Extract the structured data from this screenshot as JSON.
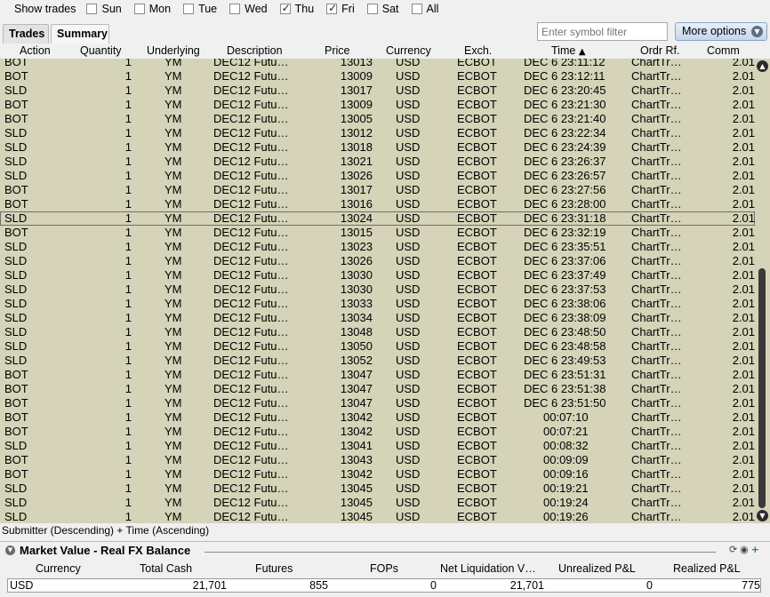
{
  "filter_bar": {
    "label": "Show trades",
    "days": [
      {
        "label": "Sun",
        "checked": false
      },
      {
        "label": "Mon",
        "checked": false
      },
      {
        "label": "Tue",
        "checked": false
      },
      {
        "label": "Wed",
        "checked": false
      },
      {
        "label": "Thu",
        "checked": true
      },
      {
        "label": "Fri",
        "checked": true
      },
      {
        "label": "Sat",
        "checked": false
      },
      {
        "label": "All",
        "checked": false
      }
    ]
  },
  "tabs": [
    "Trades",
    "Summary"
  ],
  "symbol_filter_placeholder": "Enter symbol filter",
  "more_options_label": "More options",
  "columns": [
    "Action",
    "Quantity",
    "Underlying",
    "Description",
    "Price",
    "Currency",
    "Exch.",
    "Time",
    "Ordr Rf.",
    "Comm"
  ],
  "trades": [
    [
      "BOT",
      "1",
      "YM",
      "DEC12 Futu…",
      "13013",
      "USD",
      "ECBOT",
      "DEC 6 23:11:12",
      "ChartTr…",
      "2.01"
    ],
    [
      "BOT",
      "1",
      "YM",
      "DEC12 Futu…",
      "13009",
      "USD",
      "ECBOT",
      "DEC 6 23:12:11",
      "ChartTr…",
      "2.01"
    ],
    [
      "SLD",
      "1",
      "YM",
      "DEC12 Futu…",
      "13017",
      "USD",
      "ECBOT",
      "DEC 6 23:20:45",
      "ChartTr…",
      "2.01"
    ],
    [
      "BOT",
      "1",
      "YM",
      "DEC12 Futu…",
      "13009",
      "USD",
      "ECBOT",
      "DEC 6 23:21:30",
      "ChartTr…",
      "2.01"
    ],
    [
      "BOT",
      "1",
      "YM",
      "DEC12 Futu…",
      "13005",
      "USD",
      "ECBOT",
      "DEC 6 23:21:40",
      "ChartTr…",
      "2.01"
    ],
    [
      "SLD",
      "1",
      "YM",
      "DEC12 Futu…",
      "13012",
      "USD",
      "ECBOT",
      "DEC 6 23:22:34",
      "ChartTr…",
      "2.01"
    ],
    [
      "SLD",
      "1",
      "YM",
      "DEC12 Futu…",
      "13018",
      "USD",
      "ECBOT",
      "DEC 6 23:24:39",
      "ChartTr…",
      "2.01"
    ],
    [
      "SLD",
      "1",
      "YM",
      "DEC12 Futu…",
      "13021",
      "USD",
      "ECBOT",
      "DEC 6 23:26:37",
      "ChartTr…",
      "2.01"
    ],
    [
      "SLD",
      "1",
      "YM",
      "DEC12 Futu…",
      "13026",
      "USD",
      "ECBOT",
      "DEC 6 23:26:57",
      "ChartTr…",
      "2.01"
    ],
    [
      "BOT",
      "1",
      "YM",
      "DEC12 Futu…",
      "13017",
      "USD",
      "ECBOT",
      "DEC 6 23:27:56",
      "ChartTr…",
      "2.01"
    ],
    [
      "BOT",
      "1",
      "YM",
      "DEC12 Futu…",
      "13016",
      "USD",
      "ECBOT",
      "DEC 6 23:28:00",
      "ChartTr…",
      "2.01"
    ],
    [
      "SLD",
      "1",
      "YM",
      "DEC12 Futu…",
      "13024",
      "USD",
      "ECBOT",
      "DEC 6 23:31:18",
      "ChartTr…",
      "2.01"
    ],
    [
      "BOT",
      "1",
      "YM",
      "DEC12 Futu…",
      "13015",
      "USD",
      "ECBOT",
      "DEC 6 23:32:19",
      "ChartTr…",
      "2.01"
    ],
    [
      "SLD",
      "1",
      "YM",
      "DEC12 Futu…",
      "13023",
      "USD",
      "ECBOT",
      "DEC 6 23:35:51",
      "ChartTr…",
      "2.01"
    ],
    [
      "SLD",
      "1",
      "YM",
      "DEC12 Futu…",
      "13026",
      "USD",
      "ECBOT",
      "DEC 6 23:37:06",
      "ChartTr…",
      "2.01"
    ],
    [
      "SLD",
      "1",
      "YM",
      "DEC12 Futu…",
      "13030",
      "USD",
      "ECBOT",
      "DEC 6 23:37:49",
      "ChartTr…",
      "2.01"
    ],
    [
      "SLD",
      "1",
      "YM",
      "DEC12 Futu…",
      "13030",
      "USD",
      "ECBOT",
      "DEC 6 23:37:53",
      "ChartTr…",
      "2.01"
    ],
    [
      "SLD",
      "1",
      "YM",
      "DEC12 Futu…",
      "13033",
      "USD",
      "ECBOT",
      "DEC 6 23:38:06",
      "ChartTr…",
      "2.01"
    ],
    [
      "SLD",
      "1",
      "YM",
      "DEC12 Futu…",
      "13034",
      "USD",
      "ECBOT",
      "DEC 6 23:38:09",
      "ChartTr…",
      "2.01"
    ],
    [
      "SLD",
      "1",
      "YM",
      "DEC12 Futu…",
      "13048",
      "USD",
      "ECBOT",
      "DEC 6 23:48:50",
      "ChartTr…",
      "2.01"
    ],
    [
      "SLD",
      "1",
      "YM",
      "DEC12 Futu…",
      "13050",
      "USD",
      "ECBOT",
      "DEC 6 23:48:58",
      "ChartTr…",
      "2.01"
    ],
    [
      "SLD",
      "1",
      "YM",
      "DEC12 Futu…",
      "13052",
      "USD",
      "ECBOT",
      "DEC 6 23:49:53",
      "ChartTr…",
      "2.01"
    ],
    [
      "BOT",
      "1",
      "YM",
      "DEC12 Futu…",
      "13047",
      "USD",
      "ECBOT",
      "DEC 6 23:51:31",
      "ChartTr…",
      "2.01"
    ],
    [
      "BOT",
      "1",
      "YM",
      "DEC12 Futu…",
      "13047",
      "USD",
      "ECBOT",
      "DEC 6 23:51:38",
      "ChartTr…",
      "2.01"
    ],
    [
      "BOT",
      "1",
      "YM",
      "DEC12 Futu…",
      "13047",
      "USD",
      "ECBOT",
      "DEC 6 23:51:50",
      "ChartTr…",
      "2.01"
    ],
    [
      "BOT",
      "1",
      "YM",
      "DEC12 Futu…",
      "13042",
      "USD",
      "ECBOT",
      "00:07:10",
      "ChartTr…",
      "2.01"
    ],
    [
      "BOT",
      "1",
      "YM",
      "DEC12 Futu…",
      "13042",
      "USD",
      "ECBOT",
      "00:07:21",
      "ChartTr…",
      "2.01"
    ],
    [
      "SLD",
      "1",
      "YM",
      "DEC12 Futu…",
      "13041",
      "USD",
      "ECBOT",
      "00:08:32",
      "ChartTr…",
      "2.01"
    ],
    [
      "BOT",
      "1",
      "YM",
      "DEC12 Futu…",
      "13043",
      "USD",
      "ECBOT",
      "00:09:09",
      "ChartTr…",
      "2.01"
    ],
    [
      "BOT",
      "1",
      "YM",
      "DEC12 Futu…",
      "13042",
      "USD",
      "ECBOT",
      "00:09:16",
      "ChartTr…",
      "2.01"
    ],
    [
      "SLD",
      "1",
      "YM",
      "DEC12 Futu…",
      "13045",
      "USD",
      "ECBOT",
      "00:19:21",
      "ChartTr…",
      "2.01"
    ],
    [
      "SLD",
      "1",
      "YM",
      "DEC12 Futu…",
      "13045",
      "USD",
      "ECBOT",
      "00:19:24",
      "ChartTr…",
      "2.01"
    ],
    [
      "SLD",
      "1",
      "YM",
      "DEC12 Futu…",
      "13045",
      "USD",
      "ECBOT",
      "00:19:26",
      "ChartTr…",
      "2.01"
    ]
  ],
  "selected_row": 11,
  "sort_text": "Submitter (Descending)  +  Time (Ascending)",
  "market_value": {
    "title": "Market Value - Real FX Balance",
    "columns": [
      "Currency",
      "Total Cash",
      "Futures",
      "FOPs",
      "Net Liquidation V…",
      "Unrealized P&L",
      "Realized P&L"
    ],
    "row": [
      "USD",
      "21,701",
      "855",
      "0",
      "21,701",
      "0",
      "775"
    ]
  },
  "colors": {
    "grid_bg": "#d5d3b8",
    "window_bg": "#f0f0f0",
    "more_options_bg": "#c6d5ea"
  },
  "icons": {
    "sort": "triangle-up",
    "scroll_up": "arrow-up",
    "scroll_down": "arrow-down",
    "collapse": "chevron-down"
  }
}
